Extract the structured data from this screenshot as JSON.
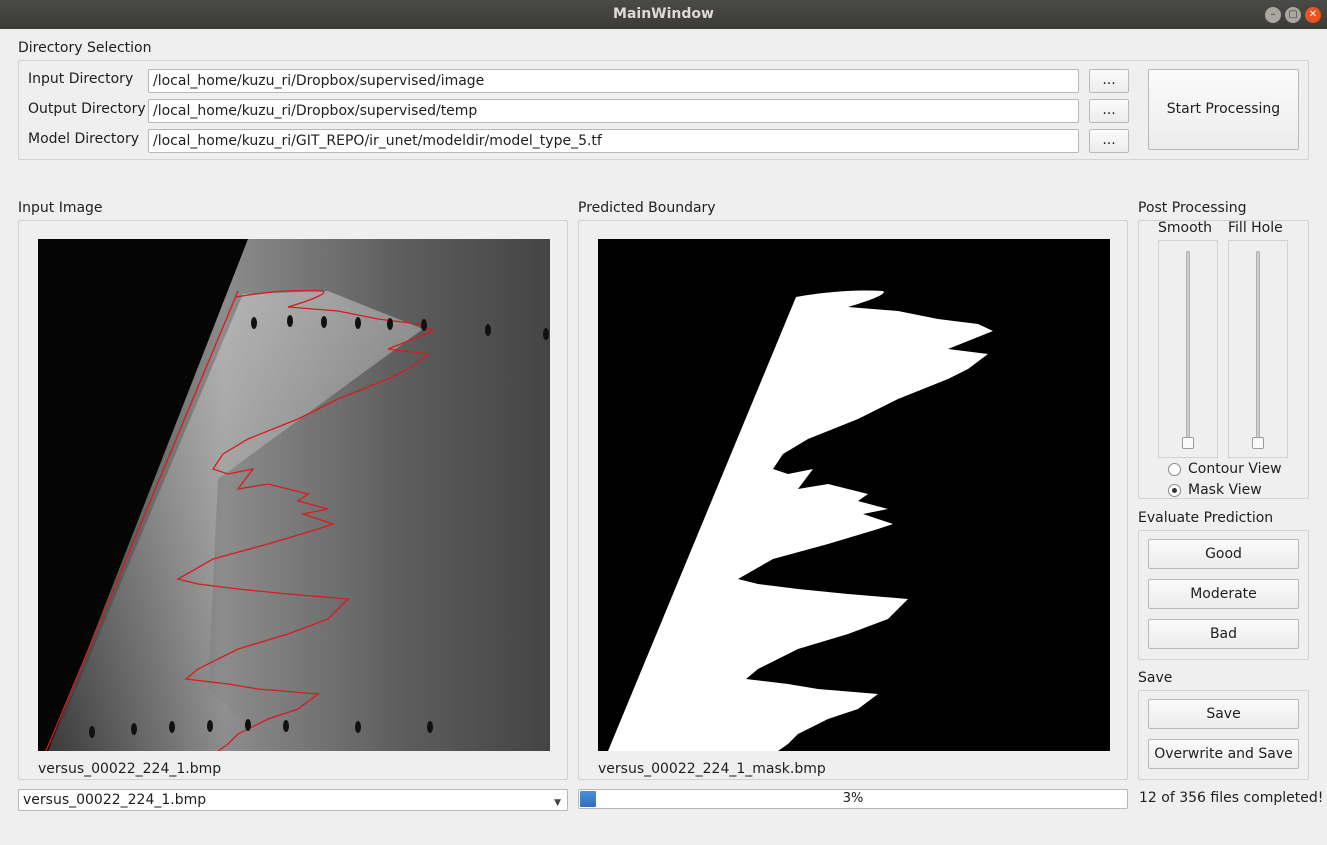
{
  "window": {
    "title": "MainWindow"
  },
  "directory": {
    "section_title": "Directory Selection",
    "input_label": "Input Directory",
    "input_value": "/local_home/kuzu_ri/Dropbox/supervised/image",
    "output_label": "Output Directory",
    "output_value": "/local_home/kuzu_ri/Dropbox/supervised/temp",
    "model_label": "Model Directory",
    "model_value": "/local_home/kuzu_ri/GIT_REPO/ir_unet/modeldir/model_type_5.tf",
    "browse_label": "...",
    "start_label": "Start Processing"
  },
  "input_panel": {
    "title": "Input Image",
    "filename": "versus_00022_224_1.bmp"
  },
  "predicted_panel": {
    "title": "Predicted Boundary",
    "filename": "versus_00022_224_1_mask.bmp"
  },
  "post_processing": {
    "title": "Post Processing",
    "smooth_label": "Smooth",
    "fill_hole_label": "Fill Hole",
    "smooth_level": 0,
    "fill_hole_level": 0,
    "contour_view_label": "Contour View",
    "mask_view_label": "Mask View",
    "selected_view": "mask"
  },
  "evaluate": {
    "title": "Evaluate Prediction",
    "good": "Good",
    "moderate": "Moderate",
    "bad": "Bad"
  },
  "save": {
    "title": "Save",
    "save_label": "Save",
    "overwrite_label": "Overwrite and Save"
  },
  "footer": {
    "file_select": "versus_00022_224_1.bmp",
    "progress_percent": 3,
    "progress_text": "3%",
    "status": "12 of 356 files completed!"
  },
  "colors": {
    "contour": "#d81b1b",
    "progress": "#3a7fcf"
  }
}
